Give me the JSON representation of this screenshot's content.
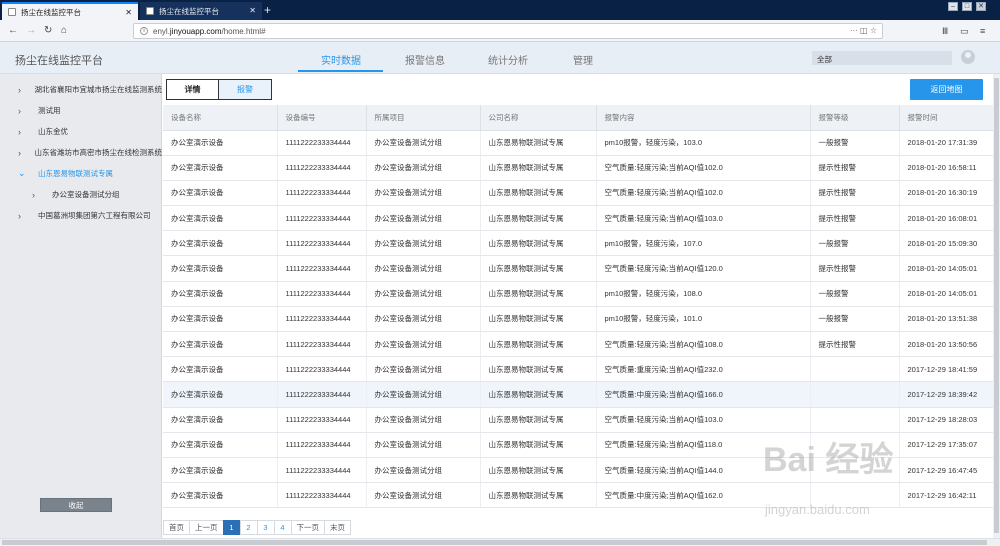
{
  "browser": {
    "tabs": [
      {
        "label": "扬尘在线监控平台"
      },
      {
        "label": "扬尘在线监控平台"
      }
    ],
    "url_prefix": "enyl.",
    "url_domain": "jinyouapp.com",
    "url_path": "/home.html#"
  },
  "header": {
    "brand": "扬尘在线监控平台",
    "nav": [
      "实时数据",
      "报警信息",
      "统计分析",
      "管理"
    ],
    "scope": "全部"
  },
  "sidebar": {
    "items": [
      {
        "label": "湖北省襄阳市宜城市扬尘在线监测系统",
        "chevron": "›"
      },
      {
        "label": "测试用",
        "chevron": "›"
      },
      {
        "label": "山东金优",
        "chevron": "›"
      },
      {
        "label": "山东省潍坊市高密市扬尘在线检测系统",
        "chevron": "›"
      },
      {
        "label": "山东恩易物联测试专属",
        "chevron": "⌄"
      },
      {
        "label": "办公室设备测试分组",
        "chevron": "›"
      },
      {
        "label": "中国葛洲坝集团第六工程有限公司",
        "chevron": "›"
      }
    ],
    "collapse_label": "收起"
  },
  "content": {
    "tabs": [
      "详情",
      "报警"
    ],
    "back_button": "返回地图",
    "columns": [
      "设备名称",
      "设备编号",
      "所属项目",
      "公司名称",
      "报警内容",
      "报警等级",
      "报警时间"
    ],
    "rows": [
      [
        "办公室演示设备",
        "1111222233334444",
        "办公室设备测试分组",
        "山东恩易物联测试专属",
        "pm10报警，轻度污染，103.0",
        "一般报警",
        "2018-01-20 17:31:39"
      ],
      [
        "办公室演示设备",
        "1111222233334444",
        "办公室设备测试分组",
        "山东恩易物联测试专属",
        "空气质量:轻度污染;当前AQI值102.0",
        "提示性报警",
        "2018-01-20 16:58:11"
      ],
      [
        "办公室演示设备",
        "1111222233334444",
        "办公室设备测试分组",
        "山东恩易物联测试专属",
        "空气质量:轻度污染;当前AQI值102.0",
        "提示性报警",
        "2018-01-20 16:30:19"
      ],
      [
        "办公室演示设备",
        "1111222233334444",
        "办公室设备测试分组",
        "山东恩易物联测试专属",
        "空气质量:轻度污染;当前AQI值103.0",
        "提示性报警",
        "2018-01-20 16:08:01"
      ],
      [
        "办公室演示设备",
        "1111222233334444",
        "办公室设备测试分组",
        "山东恩易物联测试专属",
        "pm10报警，轻度污染，107.0",
        "一般报警",
        "2018-01-20 15:09:30"
      ],
      [
        "办公室演示设备",
        "1111222233334444",
        "办公室设备测试分组",
        "山东恩易物联测试专属",
        "空气质量:轻度污染;当前AQI值120.0",
        "提示性报警",
        "2018-01-20 14:05:01"
      ],
      [
        "办公室演示设备",
        "1111222233334444",
        "办公室设备测试分组",
        "山东恩易物联测试专属",
        "pm10报警，轻度污染，108.0",
        "一般报警",
        "2018-01-20 14:05:01"
      ],
      [
        "办公室演示设备",
        "1111222233334444",
        "办公室设备测试分组",
        "山东恩易物联测试专属",
        "pm10报警，轻度污染，101.0",
        "一般报警",
        "2018-01-20 13:51:38"
      ],
      [
        "办公室演示设备",
        "1111222233334444",
        "办公室设备测试分组",
        "山东恩易物联测试专属",
        "空气质量:轻度污染;当前AQI值108.0",
        "提示性报警",
        "2018-01-20 13:50:56"
      ],
      [
        "办公室演示设备",
        "1111222233334444",
        "办公室设备测试分组",
        "山东恩易物联测试专属",
        "空气质量:重度污染;当前AQI值232.0",
        "",
        "2017-12-29 18:41:59"
      ],
      [
        "办公室演示设备",
        "1111222233334444",
        "办公室设备测试分组",
        "山东恩易物联测试专属",
        "空气质量:中度污染;当前AQI值166.0",
        "",
        "2017-12-29 18:39:42"
      ],
      [
        "办公室演示设备",
        "1111222233334444",
        "办公室设备测试分组",
        "山东恩易物联测试专属",
        "空气质量:轻度污染;当前AQI值103.0",
        "",
        "2017-12-29 18:28:03"
      ],
      [
        "办公室演示设备",
        "1111222233334444",
        "办公室设备测试分组",
        "山东恩易物联测试专属",
        "空气质量:轻度污染;当前AQI值118.0",
        "",
        "2017-12-29 17:35:07"
      ],
      [
        "办公室演示设备",
        "1111222233334444",
        "办公室设备测试分组",
        "山东恩易物联测试专属",
        "空气质量:轻度污染;当前AQI值144.0",
        "",
        "2017-12-29 16:47:45"
      ],
      [
        "办公室演示设备",
        "1111222233334444",
        "办公室设备测试分组",
        "山东恩易物联测试专属",
        "空气质量:中度污染;当前AQI值162.0",
        "",
        "2017-12-29 16:42:11"
      ]
    ],
    "pager": {
      "first": "首页",
      "prev": "上一页",
      "pages": [
        "1",
        "2",
        "3",
        "4"
      ],
      "current": "1",
      "next": "下一页",
      "last": "末页"
    }
  },
  "watermark": {
    "main": "Bai 经验",
    "sub": "jingyan.baidu.com"
  },
  "colors": {
    "accent": "#2795e9",
    "chrome_dark": "#0a2146",
    "pager_current": "#2b6fb4"
  }
}
